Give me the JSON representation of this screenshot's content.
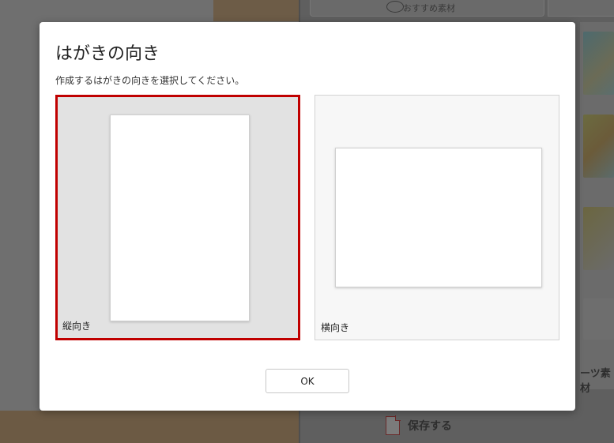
{
  "background": {
    "tab_label": "おすすめ素材",
    "parts_label": "ーツ素材",
    "save_label": "保存する"
  },
  "dialog": {
    "title": "はがきの向き",
    "subtitle": "作成するはがきの向きを選択してください。",
    "options": [
      {
        "label": "縦向き",
        "selected": true
      },
      {
        "label": "横向き",
        "selected": false
      }
    ],
    "ok_label": "OK"
  },
  "colors": {
    "selected_border": "#c00000",
    "overlay": "#5d5d5d"
  }
}
